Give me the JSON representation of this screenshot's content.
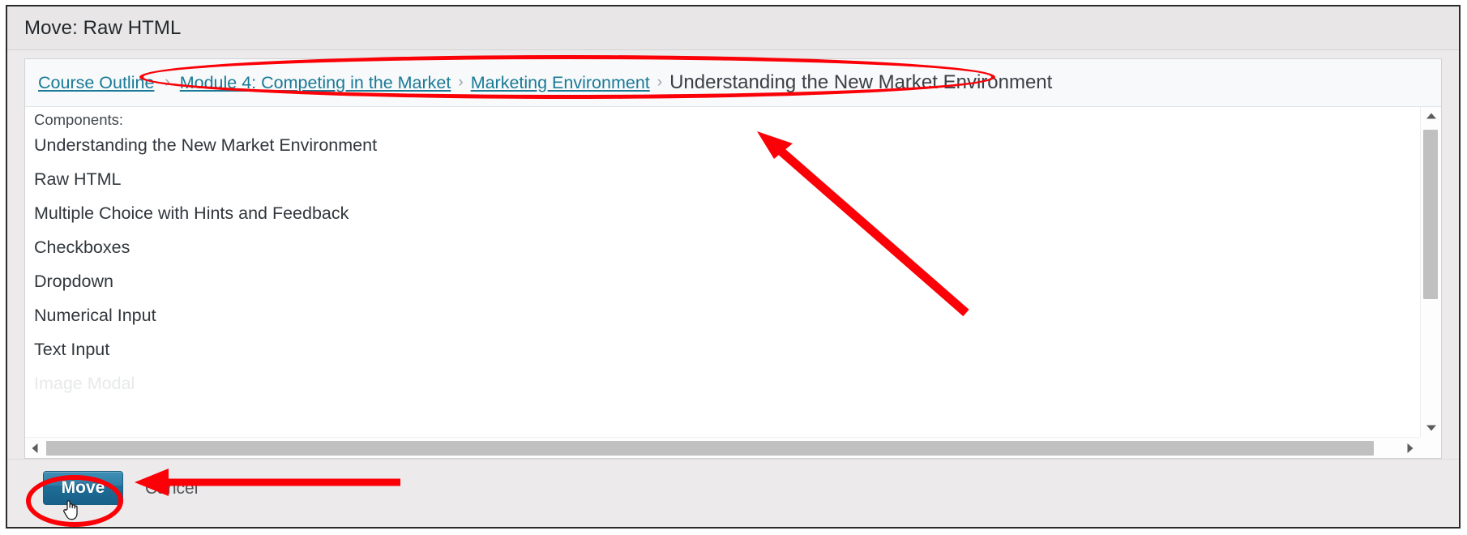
{
  "window": {
    "title": "Move: Raw HTML"
  },
  "breadcrumb": {
    "root_label": "Course Outline",
    "separator": "›",
    "items": [
      {
        "label": "Module 4: Competing in the Market",
        "type": "link"
      },
      {
        "label": "Marketing Environment",
        "type": "link"
      },
      {
        "label": "Understanding the New Market Environment",
        "type": "current"
      }
    ]
  },
  "components_panel": {
    "heading": "Components:",
    "items": [
      {
        "label": "Understanding the New Market Environment"
      },
      {
        "label": "Raw HTML"
      },
      {
        "label": "Multiple Choice with Hints and Feedback"
      },
      {
        "label": "Checkboxes"
      },
      {
        "label": "Dropdown"
      },
      {
        "label": "Numerical Input"
      },
      {
        "label": "Text Input"
      },
      {
        "label": "Image Modal"
      }
    ]
  },
  "scrollbars": {
    "vertical": {
      "up_arrow": "▲",
      "down_arrow": "▼"
    },
    "horizontal": {
      "left_arrow": "◄",
      "right_arrow": "►"
    }
  },
  "footer": {
    "move_label": "Move",
    "cancel_label": "Cancel"
  },
  "annotations": {
    "accent_color": "#fb0007",
    "breadcrumb_highlight": "ellipse-around-breadcrumb-path",
    "breadcrumb_pointer": "diagonal-arrow-to-breadcrumb",
    "move_highlight": "circle-around-move-button",
    "move_pointer": "horizontal-arrow-to-move-button"
  },
  "colors": {
    "link": "#1a7a96",
    "title_text": "#23282c",
    "button_primary": "#2d7da6",
    "panel_background": "#ffffff",
    "chrome_background": "#eceaea"
  }
}
